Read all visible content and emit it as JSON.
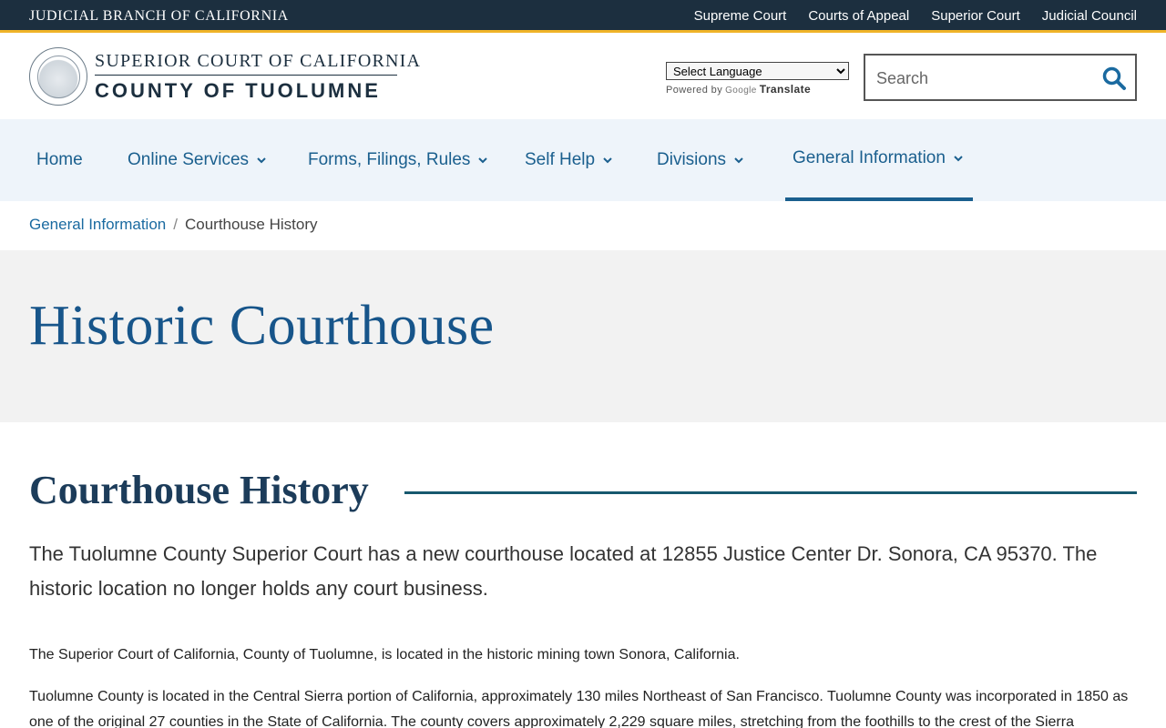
{
  "topbar": {
    "brand": "JUDICIAL BRANCH OF CALIFORNIA",
    "links": [
      "Supreme Court",
      "Courts of Appeal",
      "Superior Court",
      "Judicial Council"
    ]
  },
  "header": {
    "logo_line1": "SUPERIOR COURT OF CALIFORNIA",
    "logo_line2": "COUNTY OF TUOLUMNE",
    "language_select": "Select Language",
    "powered_by": "Powered by",
    "google": "Google",
    "translate": "Translate",
    "search_placeholder": "Search"
  },
  "nav": {
    "items": [
      {
        "label": "Home"
      },
      {
        "label": "Online Services"
      },
      {
        "label": "Forms, Filings, Rules"
      },
      {
        "label": "Self Help"
      },
      {
        "label": "Divisions"
      },
      {
        "label": "General Information"
      }
    ]
  },
  "breadcrumb": {
    "parent": "General Information",
    "separator": "/",
    "current": "Courthouse History"
  },
  "hero": {
    "title": "Historic Courthouse"
  },
  "content": {
    "section_title": "Courthouse History",
    "lead": "The Tuolumne County Superior Court has a new courthouse located at 12855 Justice Center Dr. Sonora, CA 95370. The historic location no longer holds any court business.",
    "para1": "The Superior Court of California, County of Tuolumne, is located in the historic mining town Sonora, California.",
    "para2": "Tuolumne County is located in the Central Sierra portion of California, approximately 130 miles Northeast of San Francisco. Tuolumne County was incorporated in 1850 as one of the original 27 counties in the State of California. The county covers approximately 2,229 square miles, stretching from the foothills to the crest of the Sierra"
  },
  "colors": {
    "topbar": "#1c2f3f",
    "accent_gold": "#f0b429",
    "link_blue": "#1a5f8e",
    "nav_bg": "#eef4fa",
    "hero_bg": "#f2f2f2"
  }
}
